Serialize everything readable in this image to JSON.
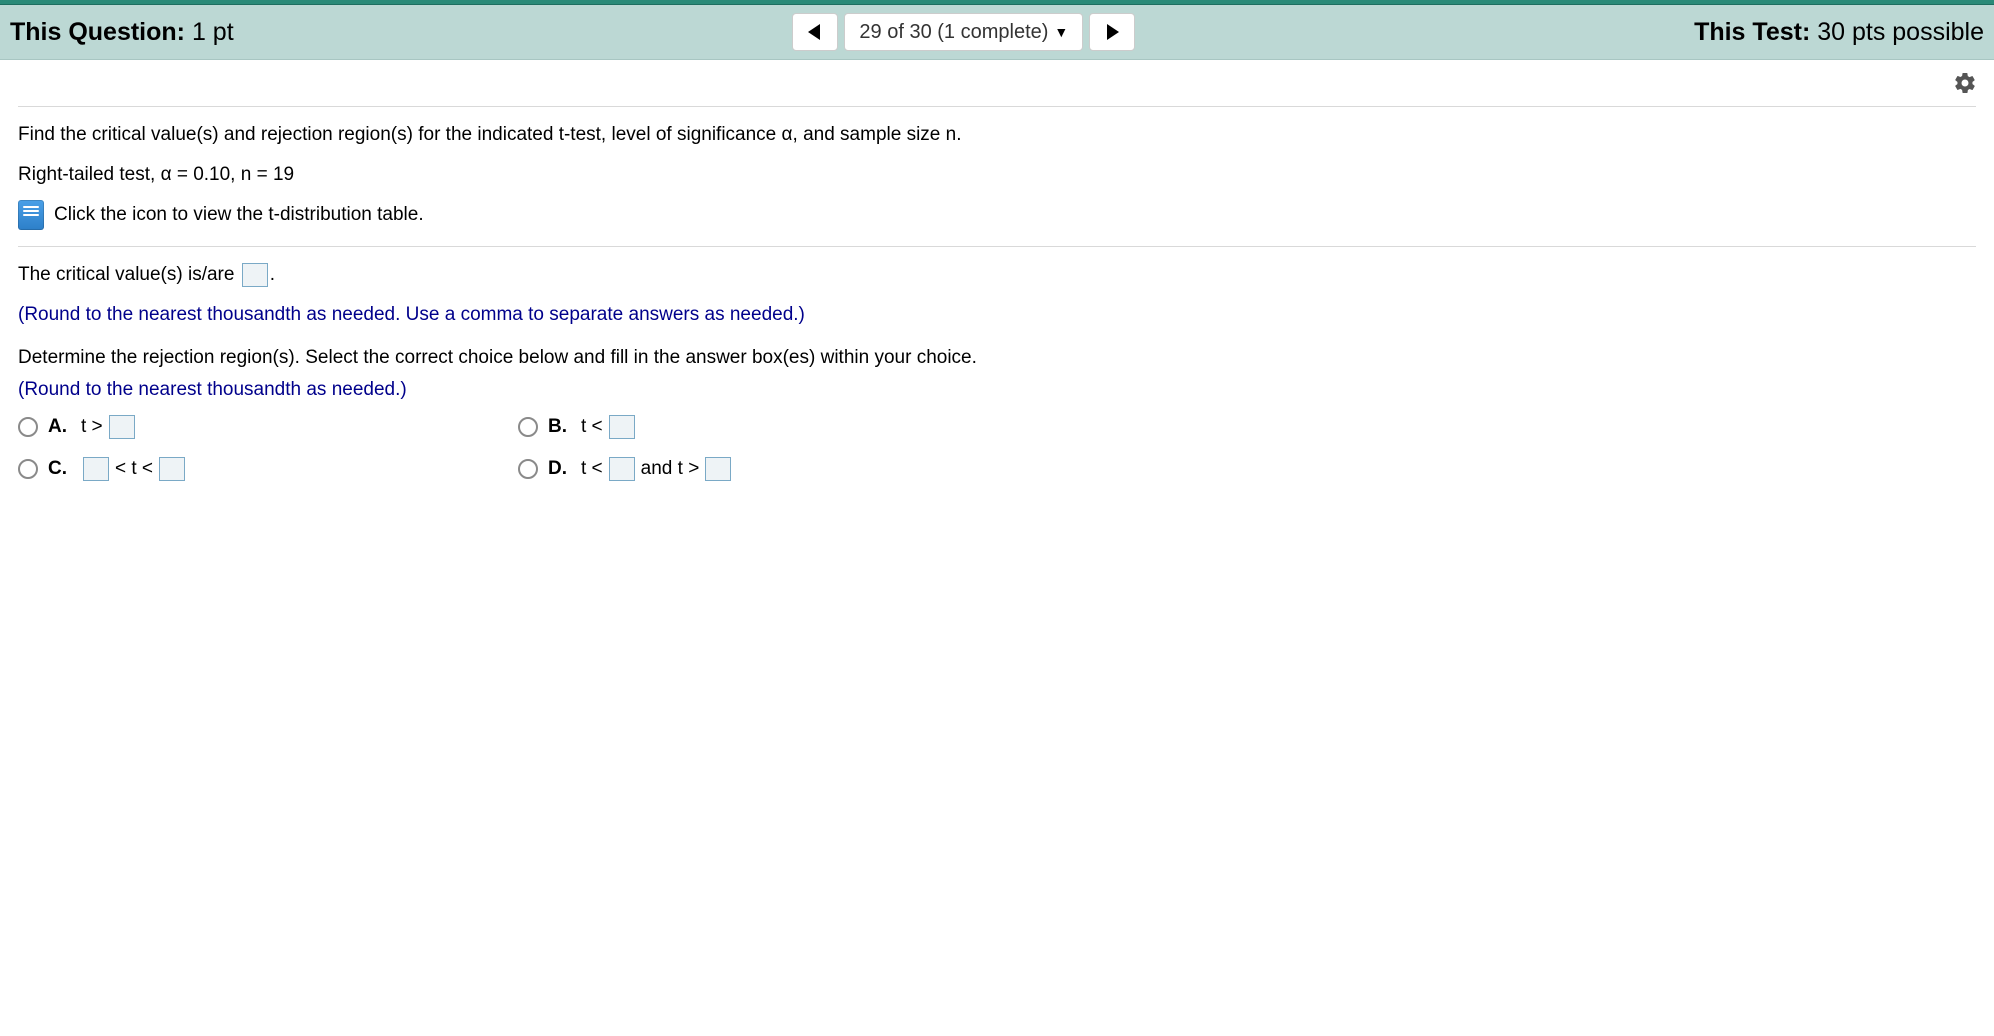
{
  "header": {
    "questionLabel": "This Question:",
    "questionPts": " 1 pt",
    "navStatus": "29 of 30 (1 complete)",
    "testLabel": "This Test:",
    "testPts": " 30 pts possible"
  },
  "problem": {
    "line1": "Find the critical value(s) and rejection region(s) for the indicated t-test, level of significance α, and sample size n.",
    "line2": "Right-tailed test, α = 0.10, n = 19",
    "iconLinkText": "Click the icon to view the t-distribution table."
  },
  "answerArea": {
    "critValPrefix": "The critical value(s) is/are ",
    "critValSuffix": ".",
    "hint1": "(Round to the nearest thousandth as needed. Use a comma to separate answers as needed.)",
    "rejPrompt": "Determine the rejection region(s). Select the correct choice below and fill in the answer box(es) within your choice.",
    "hint2": "(Round to the nearest thousandth as needed.)"
  },
  "choices": {
    "A": {
      "label": "A.",
      "pre": "t >"
    },
    "B": {
      "label": "B.",
      "pre": "t <"
    },
    "C": {
      "label": "C.",
      "mid": "< t <"
    },
    "D": {
      "label": "D.",
      "pre": "t <",
      "mid": " and t >"
    }
  }
}
